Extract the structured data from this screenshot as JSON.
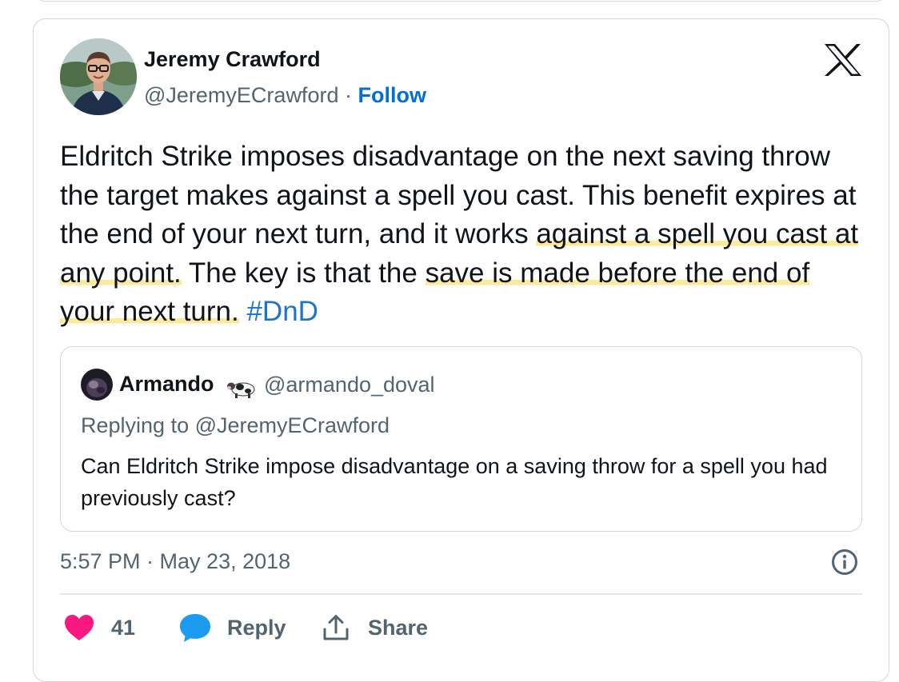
{
  "author": {
    "name": "Jeremy Crawford",
    "handle": "@JeremyECrawford",
    "separator": "·",
    "follow_label": "Follow"
  },
  "tweet": {
    "text_part1": "Eldritch Strike imposes disadvantage on the next saving throw the target makes against a spell you cast. This benefit expires at the end of your next turn, and it works ",
    "highlight1": "against a spell you cast at any point.",
    "text_part2": " The key is that the ",
    "highlight2": "save is made before the end of your next turn.",
    "text_part3": " ",
    "hashtag": "#DnD"
  },
  "quote": {
    "name": "Armando",
    "handle": "@armando_doval",
    "replying_to": "Replying to @JeremyECrawford",
    "text": "Can Eldritch Strike impose disadvantage on a saving throw for a spell you had previously cast?"
  },
  "timestamp": "5:57 PM · May 23, 2018",
  "actions": {
    "likes_count": "41",
    "reply_label": "Reply",
    "share_label": "Share"
  },
  "colors": {
    "follow": "#006fd6",
    "hashtag": "#1d74d0",
    "like": "#f91880",
    "reply_bubble": "#1d9bf0",
    "highlight": "#fde99a",
    "muted": "#536471"
  },
  "icons": [
    "x-logo-icon",
    "info-icon",
    "heart-icon",
    "reply-bubble-icon",
    "share-icon",
    "cow-emoji-icon"
  ]
}
